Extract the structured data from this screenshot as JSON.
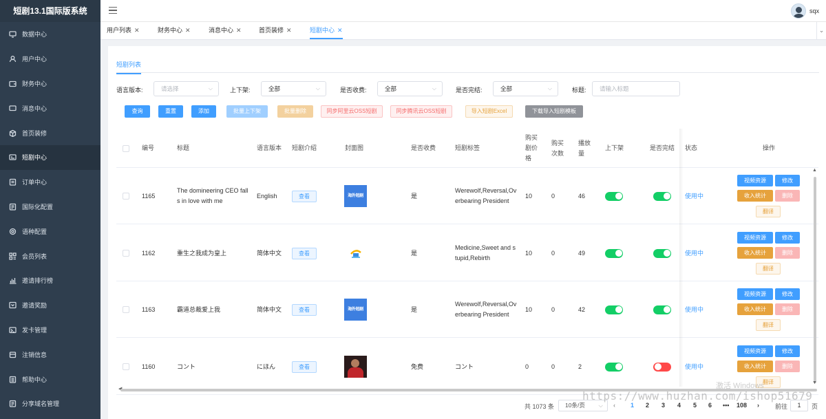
{
  "app": {
    "title": "短剧13.1国际版系统",
    "username": "sqx"
  },
  "sidebar": {
    "items": [
      {
        "label": "数据中心",
        "icon": "monitor-icon"
      },
      {
        "label": "用户中心",
        "icon": "user-icon"
      },
      {
        "label": "财务中心",
        "icon": "wallet-icon"
      },
      {
        "label": "消息中心",
        "icon": "message-icon"
      },
      {
        "label": "首页装修",
        "icon": "box-icon"
      },
      {
        "label": "短剧中心",
        "icon": "video-icon"
      },
      {
        "label": "订单中心",
        "icon": "order-icon"
      },
      {
        "label": "国际化配置",
        "icon": "document-icon"
      },
      {
        "label": "语种配置",
        "icon": "gear-icon"
      },
      {
        "label": "会员列表",
        "icon": "grid-icon"
      },
      {
        "label": "邀请排行榜",
        "icon": "bar-chart-icon"
      },
      {
        "label": "邀请奖励",
        "icon": "reward-icon"
      },
      {
        "label": "发卡管理",
        "icon": "card-icon"
      },
      {
        "label": "注销信息",
        "icon": "logout-icon"
      },
      {
        "label": "帮助中心",
        "icon": "help-icon"
      },
      {
        "label": "分享域名管理",
        "icon": "share-icon"
      }
    ],
    "active_index": 5
  },
  "tabs": [
    {
      "label": "用户列表"
    },
    {
      "label": "财务中心"
    },
    {
      "label": "消息中心"
    },
    {
      "label": "首页装修"
    },
    {
      "label": "短剧中心",
      "active": true
    }
  ],
  "subtab": "短剧列表",
  "filters": {
    "language": {
      "label": "语言版本:",
      "placeholder": "请选择"
    },
    "shelf": {
      "label": "上下架:",
      "value": "全部"
    },
    "paid": {
      "label": "是否收费:",
      "value": "全部"
    },
    "finished": {
      "label": "是否完结:",
      "value": "全部"
    },
    "title": {
      "label": "标题:",
      "placeholder": "请输入标题"
    }
  },
  "actions": {
    "query": "查询",
    "reset": "重置",
    "add": "添加",
    "batch_shelf": "批量上下架",
    "batch_delete": "批量删除",
    "sync_aliyun": "同步阿里云OSS短剧",
    "sync_tencent": "同步腾讯云OSS短剧",
    "import_excel": "导入短剧Excel",
    "download_template": "下载导入短剧模板"
  },
  "table": {
    "headers": {
      "id": "编号",
      "title": "标题",
      "language": "语言版本",
      "intro": "短剧介绍",
      "cover": "封面图",
      "paid": "是否收费",
      "tags": "短剧标签",
      "buy_price": "购买剧价格",
      "buy_count": "购买次数",
      "plays": "播放量",
      "shelf": "上下架",
      "finished": "是否完结",
      "status": "状态",
      "ops": "操作"
    },
    "view_label": "查看",
    "ops_labels": {
      "video": "视频资源",
      "edit": "修改",
      "income": "收入统计",
      "delete": "删除",
      "translate": "翻译"
    },
    "rows": [
      {
        "id": "1165",
        "title": "The domineering CEO falls in love with me",
        "language": "English",
        "cover": "blue",
        "cover_text": "海外短剧",
        "paid": "是",
        "tags": "Werewolf,Reversal,Overbearing President",
        "buy_price": "10",
        "buy_count": "0",
        "plays": "46",
        "shelf": true,
        "finished": true,
        "status": "使用中"
      },
      {
        "id": "1162",
        "title": "重生之我成为皇上",
        "language": "简体中文",
        "cover": "logo",
        "cover_text": "",
        "paid": "是",
        "tags": "Medicine,Sweet and stupid,Rebirth",
        "buy_price": "10",
        "buy_count": "0",
        "plays": "49",
        "shelf": true,
        "finished": true,
        "status": "使用中"
      },
      {
        "id": "1163",
        "title": "霸道总裁爱上我",
        "language": "简体中文",
        "cover": "blue",
        "cover_text": "海外短剧",
        "paid": "是",
        "tags": "Werewolf,Reversal,Overbearing President",
        "buy_price": "10",
        "buy_count": "0",
        "plays": "42",
        "shelf": true,
        "finished": true,
        "status": "使用中"
      },
      {
        "id": "1160",
        "title": "コント",
        "language": "にほん",
        "cover": "dark",
        "cover_text": "",
        "paid": "免费",
        "tags": "コント",
        "buy_price": "0",
        "buy_count": "0",
        "plays": "2",
        "shelf": true,
        "finished": false,
        "status": "使用中"
      }
    ]
  },
  "pagination": {
    "total": "共 1073 条",
    "page_size": "10条/页",
    "pages": [
      "1",
      "2",
      "3",
      "4",
      "5",
      "6",
      "•••",
      "108"
    ],
    "current": "1",
    "goto_label": "前往",
    "goto_value": "1",
    "page_suffix": "页"
  },
  "overlay": {
    "watermark": "https://www.huzhan.com/ishop51679",
    "windows_activation": "激活 Windows"
  }
}
